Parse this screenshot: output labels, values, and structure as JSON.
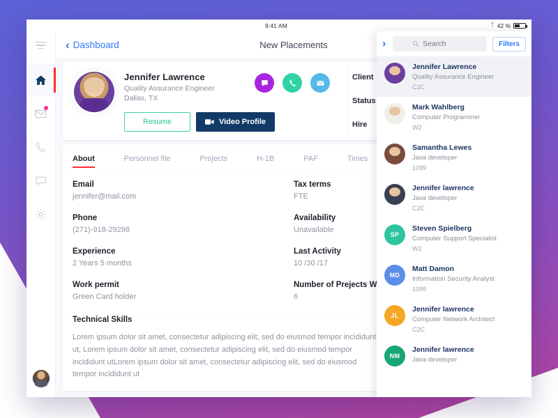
{
  "statusbar": {
    "time": "9:41 AM",
    "battery_percent": "42 %",
    "bluetooth_icon": "bluetooth-icon"
  },
  "topbar": {
    "back_label": "Dashboard",
    "title": "New Placements",
    "menu_icon": "hamburger-menu-icon"
  },
  "rail": {
    "items": [
      {
        "icon": "home-icon",
        "name": "home",
        "active": true,
        "badge": false
      },
      {
        "icon": "mail-icon",
        "name": "messages",
        "active": false,
        "badge": true
      },
      {
        "icon": "phone-icon",
        "name": "calls",
        "active": false,
        "badge": false
      },
      {
        "icon": "chat-icon",
        "name": "chat",
        "active": false,
        "badge": false
      },
      {
        "icon": "gear-icon",
        "name": "settings",
        "active": false,
        "badge": false
      }
    ],
    "avatar_name": "user-avatar"
  },
  "profile": {
    "name": "Jennifer Lawrence",
    "role": "Quality Assurance Engineer",
    "location": "Dallas, TX",
    "resume_label": "Resume",
    "video_label": "Video Profile",
    "video_icon": "video-camera-icon",
    "actions": [
      {
        "name": "chat-action",
        "icon": "chat-bubble-icon",
        "color": "#a924e0"
      },
      {
        "name": "call-action",
        "icon": "phone-icon",
        "color": "#2ed4a6"
      },
      {
        "name": "email-action",
        "icon": "envelope-icon",
        "color": "#56b9ea"
      }
    ],
    "meta_labels": [
      "Client",
      "Status",
      "Hire"
    ]
  },
  "tabs": [
    {
      "label": "About",
      "active": true
    },
    {
      "label": "Personnel file",
      "active": false
    },
    {
      "label": "Projects",
      "active": false
    },
    {
      "label": "H-1B",
      "active": false
    },
    {
      "label": "PAF",
      "active": false
    },
    {
      "label": "Times",
      "active": false
    }
  ],
  "details": {
    "left": [
      {
        "label": "Email",
        "value": "jennifer@mail.com"
      },
      {
        "label": "Phone",
        "value": "(271)-918-29298"
      },
      {
        "label": "Experience",
        "value": "2 Years 5 months"
      },
      {
        "label": "Work permit",
        "value": "Green Card holder"
      }
    ],
    "right": [
      {
        "label": "Tax terms",
        "value": "FTE"
      },
      {
        "label": "Availability",
        "value": "Unavailable"
      },
      {
        "label": "Last  Activity",
        "value": "10 /30 /17"
      },
      {
        "label": "Number of Prejects Worked",
        "value": "6"
      }
    ]
  },
  "skills": {
    "title": "Technical Skills",
    "body": "Lorem ipsum dolor sit amet, consectetur adipiscing elit, sed do eiusmod tempor incididunt ut, Lorem ipsum dolor sit amet, consectetur adipiscing elit, sed do eiusmod tempor incididunt utLorem ipsum dolor sit amet, consectetur adipiscing elit, sed do eiusmod tempor incididunt ut"
  },
  "panel": {
    "toggle_icon": "chevron-right-icon",
    "search_placeholder": "Search",
    "search_value": "",
    "search_icon": "search-icon",
    "filters_label": "Filters",
    "people": [
      {
        "name": "Jennifer Lawrence",
        "role": "Quality Assurance Engineer",
        "type": "C2C",
        "avatar": "photo",
        "initials": "",
        "color": "#6b3fa0",
        "selected": true
      },
      {
        "name": "Mark Wahlberg",
        "role": "Computer Programmer",
        "type": "W2",
        "avatar": "photo",
        "initials": "",
        "color": "#2b2f3a",
        "selected": false
      },
      {
        "name": "Samantha Lewes",
        "role": "Java developer",
        "type": "1099",
        "avatar": "photo",
        "initials": "",
        "color": "#7a4b3a",
        "selected": false
      },
      {
        "name": "Jennifer lawrence",
        "role": "Java developer",
        "type": "C2C",
        "avatar": "photo",
        "initials": "",
        "color": "#3a3f52",
        "selected": false
      },
      {
        "name": "Steven Spielberg",
        "role": "Computer Support Specialist",
        "type": "W2",
        "avatar": "initials",
        "initials": "SP",
        "color": "#2ec4a0",
        "selected": false
      },
      {
        "name": "Matt Damon",
        "role": "Information Security Analyst",
        "type": "1099",
        "avatar": "initials",
        "initials": "MD",
        "color": "#5b8ee8",
        "selected": false
      },
      {
        "name": "Jennifer lawrence",
        "role": "Computer Network Architect",
        "type": "C2C",
        "avatar": "initials",
        "initials": "JL",
        "color": "#f5a623",
        "selected": false
      },
      {
        "name": "Jennifer lawrence",
        "role": "Java developer",
        "type": "",
        "avatar": "initials",
        "initials": "NM",
        "color": "#18a573",
        "selected": false
      }
    ]
  },
  "colors": {
    "accent_blue": "#2f7bf6",
    "accent_red": "#ff2d37",
    "dark_navy": "#123a66",
    "green": "#2cc48c"
  }
}
